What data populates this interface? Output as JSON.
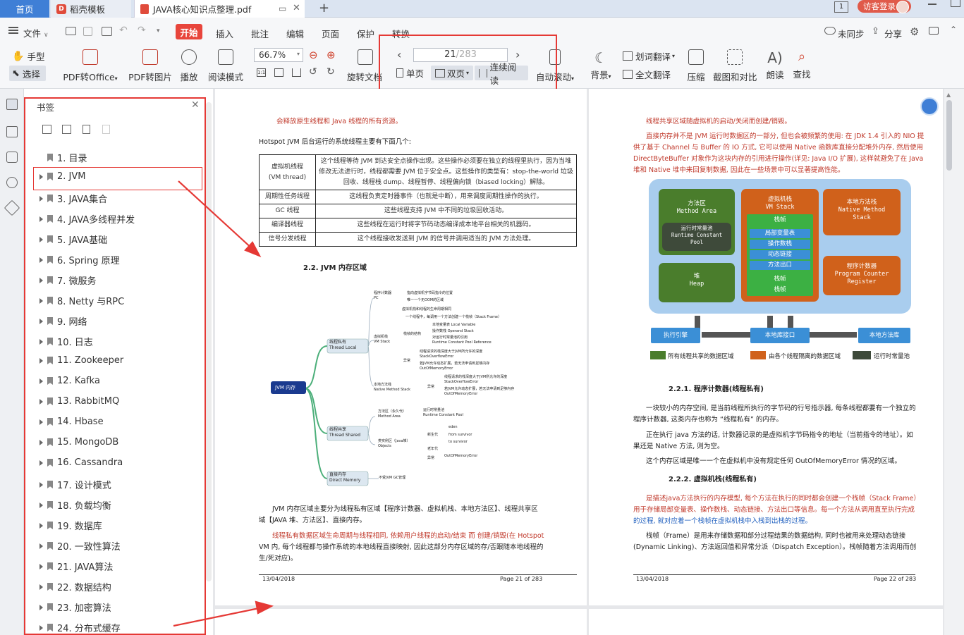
{
  "tabs": {
    "home": "首页",
    "template": "稻壳模板",
    "pdf": "JAVA核心知识点整理.pdf",
    "login": "访客登录"
  },
  "menu": {
    "file": "文件",
    "start": "开始",
    "insert": "插入",
    "annotate": "批注",
    "edit": "编辑",
    "page": "页面",
    "protect": "保护",
    "convert": "转换",
    "unsync": "未同步",
    "share": "分享"
  },
  "toolbar": {
    "hand": "手型",
    "select": "选择",
    "pdf_office": "PDF转Office",
    "pdf_image": "PDF转图片",
    "play": "播放",
    "read_mode": "阅读模式",
    "zoom": "66.7%",
    "rotate": "旋转文档",
    "page_current": "21",
    "page_total": "/283",
    "single": "单页",
    "double": "双页",
    "continuous": "连续阅读",
    "auto_scroll": "自动滚动",
    "background": "背景",
    "word_translate": "划词翻译",
    "full_translate": "全文翻译",
    "compress": "压缩",
    "screenshot": "截图和对比",
    "read_aloud": "朗读",
    "find": "查找"
  },
  "bookmarks": {
    "title": "书签",
    "items": [
      "1. 目录",
      "2. JVM",
      "3. JAVA集合",
      "4. JAVA多线程并发",
      "5. JAVA基础",
      "6. Spring 原理",
      "7.   微服务",
      "8. Netty 与RPC",
      "9. 网络",
      "10. 日志",
      "11. Zookeeper",
      "12. Kafka",
      "13. RabbitMQ",
      "14. Hbase",
      "15. MongoDB",
      "16. Cassandra",
      "17. 设计模式",
      "18. 负载均衡",
      "19. 数据库",
      "20. 一致性算法",
      "21. JAVA算法",
      "22. 数据结构",
      "23. 加密算法",
      "24. 分布式缓存"
    ]
  },
  "left_page": {
    "line1": "会释放原生线程和 Java 线程的所有资源。",
    "line2": "Hotspot JVM 后台运行的系统线程主要有下面几个:",
    "table": [
      [
        "虚拟机线程\n(VM thread)",
        "这个线程等待 JVM 到达安全点操作出现。这些操作必须要在独立的线程里执行，因为当堆修改无法进行时，线程都需要 JVM 位于安全点。这些操作的类型有：stop-the-world 垃圾回收、线程栈 dump、线程暂停、线程偏向锁（biased locking）解除。"
      ],
      [
        "周期性任务线程",
        "这线程负责定时器事件（也就是中断），用来调度周期性操作的执行。"
      ],
      [
        "GC 线程",
        "这些线程支持 JVM 中不同的垃圾回收活动。"
      ],
      [
        "编译器线程",
        "这些线程在运行时将字节码动态编译成本地平台相关的机器码。"
      ],
      [
        "信号分发线程",
        "这个线程接收发送到 JVM 的信号并调用适当的 JVM 方法处理。"
      ]
    ],
    "heading": "2.2. JVM 内存区域",
    "mind": {
      "root": "JVM 内存",
      "private": "线程私有\nThread Local",
      "shared": "线程共享\nThread Shared",
      "direct": "直接内存\nDirect Memory",
      "pc": "程序计数器\nPC",
      "pc_note1": "指向虚拟机字节码指令的位置",
      "pc_note2": "唯一一个无OOM的区域",
      "vms": "虚拟机栈\nVM Stack",
      "vms_note1": "虚拟机栈和线程的生命周期相同",
      "vms_note2": "一个线程中，每调用一个方法创建一个栈帧（Stack Frame）",
      "frame": "栈帧的结构",
      "f1": "本地变量表 Local Variable",
      "f2": "操作数栈 Operand Stack",
      "f3": "对运行时常量池的引用\nRuntime Constant Pool Reference",
      "exc": "异常",
      "e1": "线程请求的栈深度大于JVM所允许的深度\nStackOverflowError",
      "e2": "若JVM允许动态扩展，若无法申请到足够内存\nOutOfMemoryError",
      "nms": "本地方法栈\nNative Method Stack",
      "nms_exc": "异常",
      "n1": "线程请求的栈深度大于JVM所允许的深度\nStackOverflowError",
      "n2": "若JVM允许动态扩展，若无法申请到足够内存\nOutOfMemoryError",
      "ma": "方法区（永久代）\nMethod Area",
      "ma_note": "运行时常量池\nRuntime Constant Pool",
      "heap": "类实例区（Java堆）\nObjects",
      "young": "新生代",
      "eden": "eden",
      "from": "from survivor",
      "to": "to survivor",
      "old": "老年代",
      "heap_exc": "异常",
      "oom": "OutOfMemoryError",
      "direct_note": "不受JVM GC管理"
    },
    "para1": "JVM 内存区域主要分为线程私有区域【程序计数器、虚拟机栈、本地方法区】、线程共享区",
    "para1b": "域【JAVA 堆、方法区】、直接内存。",
    "para2": "线程私有数据区域生命周期与线程相同, 依赖用户线程的启动/结束 而 创建/销毁(在 Hotspot",
    "para2b": "VM 内, 每个线程都与操作系统的本地线程直接映射, 因此这部分内存区域的存/否跟随本地线程的",
    "para2c": "生/死对应)。",
    "footer_date": "13/04/2018",
    "footer_page": "Page 21 of 283"
  },
  "right_page": {
    "l1": "线程共享区域随虚拟机的启动/关闭而创建/销毁。",
    "l2": "直接内存并不是 JVM 运行时数据区的一部分, 但也会被频繁的使用: 在 JDK 1.4 引入的 NIO 提",
    "l3": "供了基于 Channel 与 Buffer 的 IO 方式, 它可以使用 Native 函数库直接分配堆外内存, 然后使用",
    "l4": "DirectByteBuffer 对象作为这块内存的引用进行操作(详见: Java I/O 扩展), 这样就避免了在 Java",
    "l5": "堆和 Native 堆中来回复制数据, 因此在一些场景中可以显著提高性能。",
    "diagram": {
      "ma": "方法区\nMethod Area",
      "rcp": "运行时常量池\nRuntime Constant\nPool",
      "vms": "虚拟机栈\nVM Stack",
      "frame": "栈帧",
      "lv": "局部变量表",
      "os": "操作数栈",
      "dl": "动态链接",
      "ret": "方法出口",
      "nms": "本地方法栈\nNative Method\nStack",
      "heap": "堆\nHeap",
      "pcr": "程序计数器\nProgram Counter\nRegister",
      "engine": "执行引擎",
      "nif": "本地库接口",
      "nlib": "本地方法库",
      "leg1": "所有线程共享的数据区域",
      "leg2": "由各个线程隔离的数据区域",
      "leg3": "运行时常量池"
    },
    "h1": "2.2.1. 程序计数器(线程私有)",
    "p1": "一块较小的内存空间, 是当前线程所执行的字节码的行号指示器, 每条线程都要有一个独立的",
    "p1b": "程序计数器, 这类内存也称为 “线程私有” 的内存。",
    "p2": "正在执行 java 方法的话, 计数器记录的是虚拟机字节码指令的地址（当前指令的地址）。如",
    "p2b": "果还是 Native 方法, 则为空。",
    "p3": "这个内存区域是唯一一个在虚拟机中没有规定任何 OutOfMemoryError 情况的区域。",
    "h2": "2.2.2. 虚拟机栈(线程私有)",
    "p4": "是描述java方法执行的内存模型, 每个方法在执行的同时都会创建一个栈帧（Stack Frame）",
    "p4b": "用于存储局部变量表、操作数栈、动态链接、方法出口等信息。每一个方法从调用直至执行完成",
    "p4c": "的过程, 就对应着一个栈帧在虚拟机栈中入栈到出栈的过程。",
    "p5": "栈帧（Frame）是用来存储数据和部分过程结果的数据结构, 同时也被用来处理动态链接",
    "p5b": "(Dynamic Linking)、方法返回值和异常分派（Dispatch Exception）。栈帧随着方法调用而创",
    "footer_date": "13/04/2018",
    "footer_page": "Page 22 of 283"
  },
  "colors": {
    "accent": "#3f7fd6",
    "start": "#e8453c",
    "annotation": "#e53935",
    "green": "#4a7d2c",
    "orange": "#d0611b",
    "blue": "#3b8fd6"
  }
}
